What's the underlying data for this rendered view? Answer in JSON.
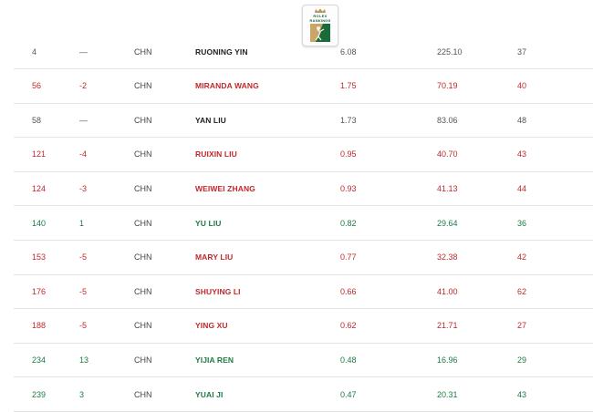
{
  "logo": {
    "line1": "ROLEX",
    "line2": "RANKINGS"
  },
  "rows": [
    {
      "rank": "4",
      "move": "—",
      "nat": "CHN",
      "name": "RUONING YIN",
      "avg": "6.08",
      "total": "225.10",
      "events": "37",
      "trend": "neutral"
    },
    {
      "rank": "56",
      "move": "-2",
      "nat": "CHN",
      "name": "MIRANDA WANG",
      "avg": "1.75",
      "total": "70.19",
      "events": "40",
      "trend": "down"
    },
    {
      "rank": "58",
      "move": "—",
      "nat": "CHN",
      "name": "YAN LIU",
      "avg": "1.73",
      "total": "83.06",
      "events": "48",
      "trend": "neutral"
    },
    {
      "rank": "121",
      "move": "-4",
      "nat": "CHN",
      "name": "RUIXIN LIU",
      "avg": "0.95",
      "total": "40.70",
      "events": "43",
      "trend": "down"
    },
    {
      "rank": "124",
      "move": "-3",
      "nat": "CHN",
      "name": "WEIWEI ZHANG",
      "avg": "0.93",
      "total": "41.13",
      "events": "44",
      "trend": "down"
    },
    {
      "rank": "140",
      "move": "1",
      "nat": "CHN",
      "name": "YU LIU",
      "avg": "0.82",
      "total": "29.64",
      "events": "36",
      "trend": "up"
    },
    {
      "rank": "153",
      "move": "-5",
      "nat": "CHN",
      "name": "MARY LIU",
      "avg": "0.77",
      "total": "32.38",
      "events": "42",
      "trend": "down"
    },
    {
      "rank": "176",
      "move": "-5",
      "nat": "CHN",
      "name": "SHUYING LI",
      "avg": "0.66",
      "total": "41.00",
      "events": "62",
      "trend": "down"
    },
    {
      "rank": "188",
      "move": "-5",
      "nat": "CHN",
      "name": "YING XU",
      "avg": "0.62",
      "total": "21.71",
      "events": "27",
      "trend": "down"
    },
    {
      "rank": "234",
      "move": "13",
      "nat": "CHN",
      "name": "YIJIA REN",
      "avg": "0.48",
      "total": "16.96",
      "events": "29",
      "trend": "up"
    },
    {
      "rank": "239",
      "move": "3",
      "nat": "CHN",
      "name": "YUAI JI",
      "avg": "0.47",
      "total": "20.31",
      "events": "43",
      "trend": "up"
    }
  ],
  "colors": {
    "down": "#c0282d",
    "up": "#1e7a44",
    "neutral": "#222222",
    "brand_green": "#1b6a3a",
    "brand_gold": "#b8955a"
  }
}
